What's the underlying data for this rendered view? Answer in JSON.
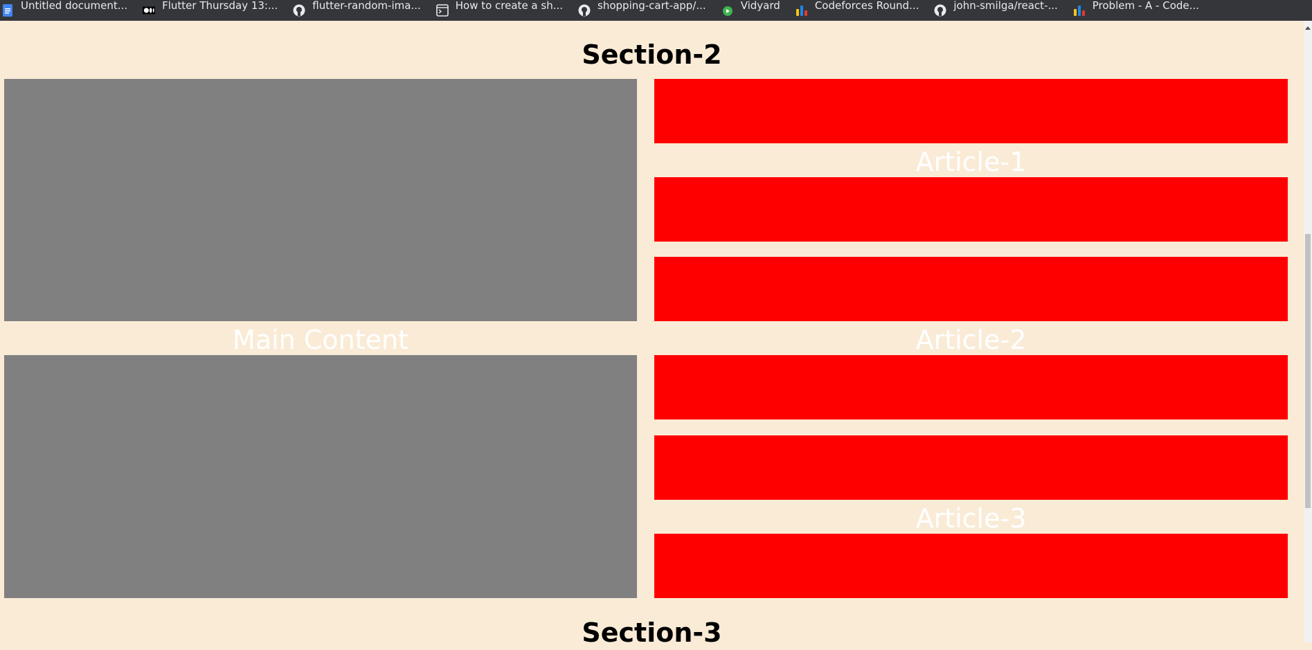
{
  "bookmarks": [
    {
      "icon": "docs-icon",
      "label": "Untitled document..."
    },
    {
      "icon": "medium-icon",
      "label": "Flutter Thursday 13:..."
    },
    {
      "icon": "github-icon",
      "label": "flutter-random-ima..."
    },
    {
      "icon": "terminal-icon",
      "label": "How to create a sh..."
    },
    {
      "icon": "github-icon",
      "label": "shopping-cart-app/..."
    },
    {
      "icon": "vidyard-icon",
      "label": "Vidyard"
    },
    {
      "icon": "codeforces-icon",
      "label": "Codeforces Round..."
    },
    {
      "icon": "github-icon",
      "label": "john-smilga/react-..."
    },
    {
      "icon": "codeforces-icon",
      "label": "Problem - A - Code..."
    }
  ],
  "page": {
    "section2_title": "Section-2",
    "main_content_label": "Main Content",
    "article1_label": "Article-1",
    "article2_label": "Article-2",
    "article3_label": "Article-3",
    "section3_title": "Section-3"
  },
  "colors": {
    "background": "#faebd7",
    "main_box": "#808080",
    "article_box": "#ff0000",
    "bookmark_bar": "#35363a"
  }
}
